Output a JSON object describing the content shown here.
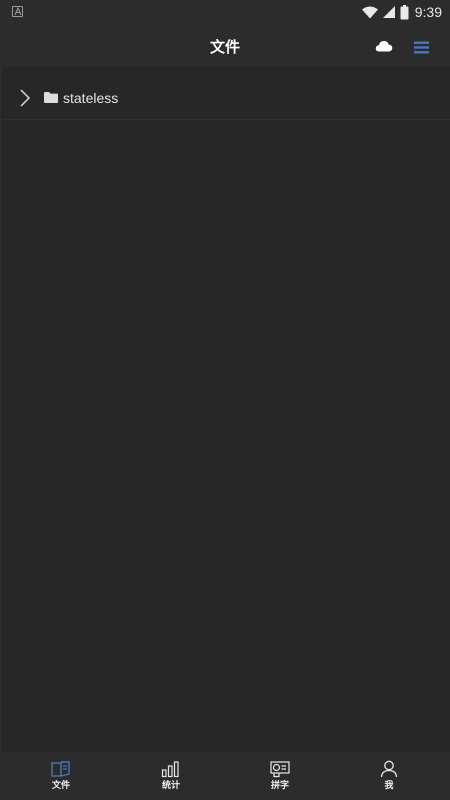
{
  "status_bar": {
    "time": "9:39",
    "left_icon": "a-letter-icon",
    "icons": [
      "wifi-icon",
      "signal-icon",
      "battery-icon"
    ]
  },
  "header": {
    "title": "文件",
    "cloud_icon": "cloud-icon",
    "menu_icon": "menu-icon"
  },
  "files": {
    "items": [
      {
        "name": "stateless",
        "type": "folder"
      }
    ]
  },
  "nav": {
    "items": [
      {
        "label": "文件",
        "icon": "files-icon",
        "active": true
      },
      {
        "label": "统计",
        "icon": "stats-icon",
        "active": false
      },
      {
        "label": "拼字",
        "icon": "spell-icon",
        "active": false
      },
      {
        "label": "我",
        "icon": "profile-icon",
        "active": false
      }
    ]
  },
  "colors": {
    "accent": "#4a78b4",
    "background": "#272727",
    "bar": "#2c2c2c"
  }
}
